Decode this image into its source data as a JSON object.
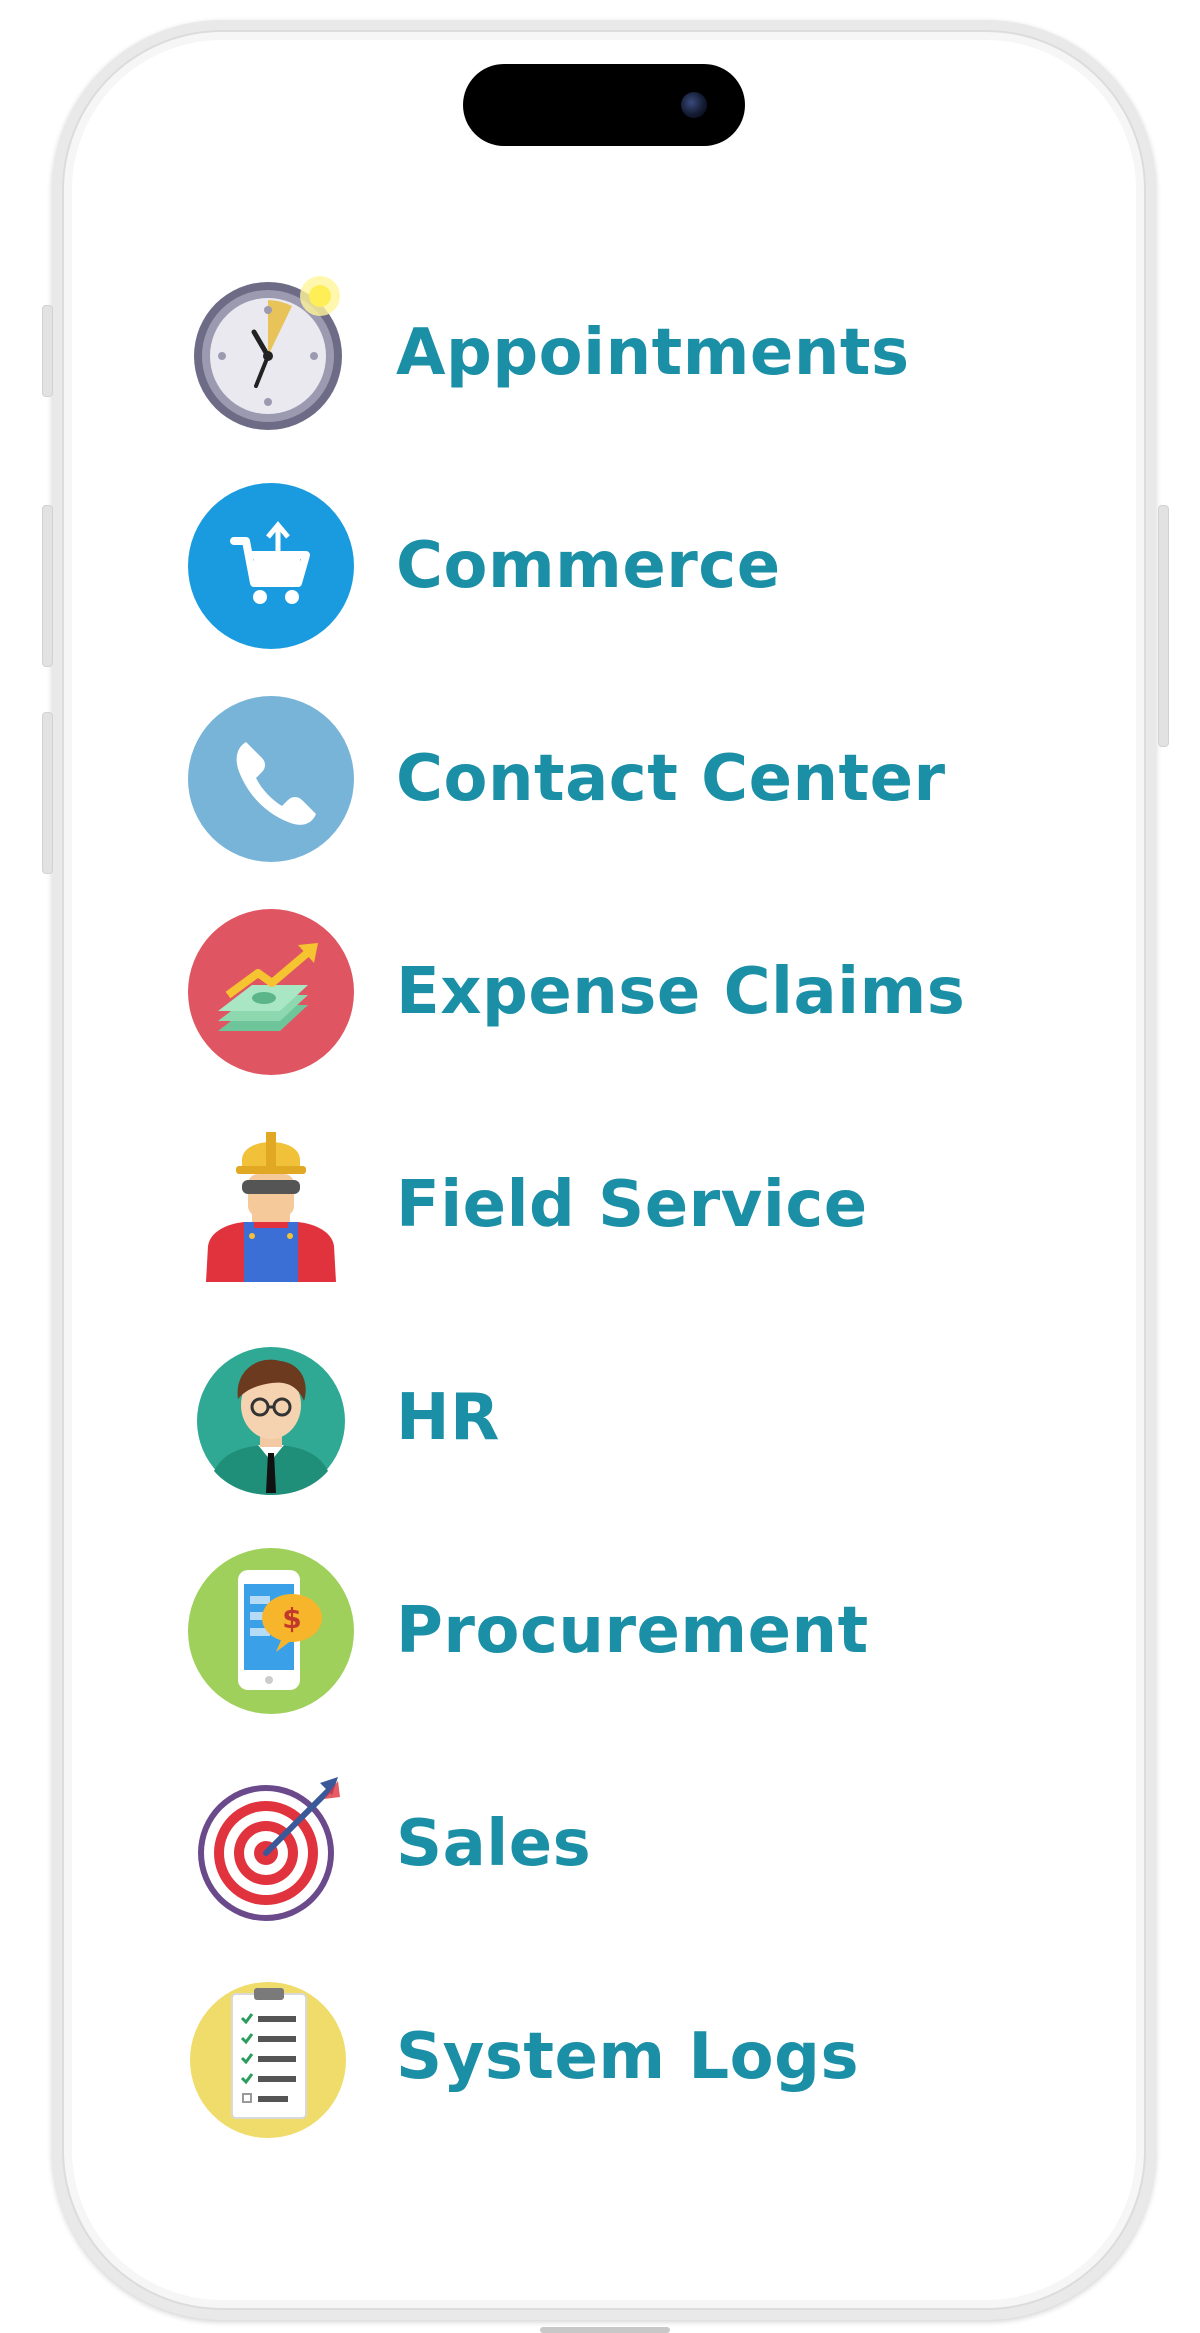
{
  "menu": {
    "items": [
      {
        "label": "Appointments",
        "icon": "clock-icon"
      },
      {
        "label": "Commerce",
        "icon": "shopping-cart-icon"
      },
      {
        "label": "Contact Center",
        "icon": "phone-icon"
      },
      {
        "label": "Expense Claims",
        "icon": "money-growth-icon"
      },
      {
        "label": "Field Service",
        "icon": "worker-icon"
      },
      {
        "label": "HR",
        "icon": "person-avatar-icon"
      },
      {
        "label": "Procurement",
        "icon": "mobile-payment-icon"
      },
      {
        "label": "Sales",
        "icon": "target-icon"
      },
      {
        "label": "System Logs",
        "icon": "checklist-icon"
      }
    ]
  },
  "colors": {
    "label_text": "#1a8fa6",
    "commerce_bg": "#1a9be0",
    "contact_center_bg": "#78b4d8",
    "expense_claims_bg": "#e05562",
    "procurement_bg": "#9fd05b",
    "system_logs_bg": "#f0dc6a"
  }
}
